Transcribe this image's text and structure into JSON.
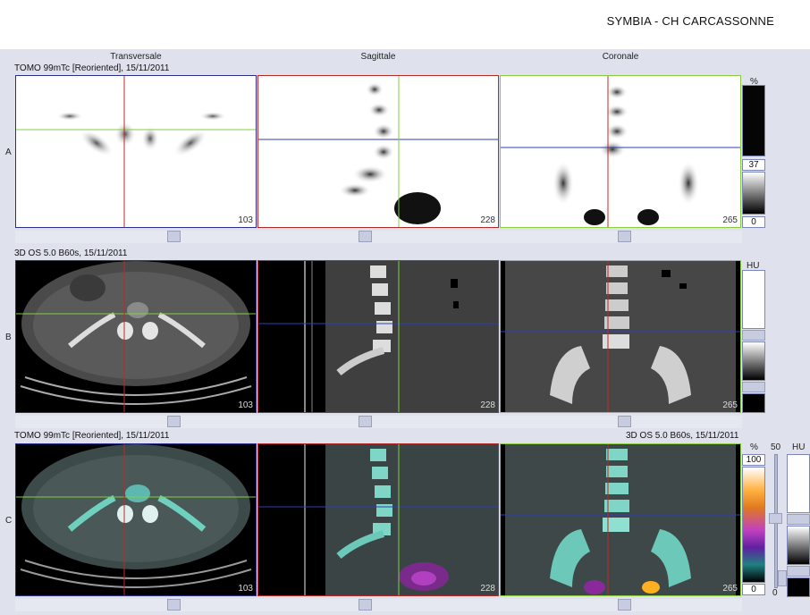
{
  "header": {
    "title": "SYMBIA - CH CARCASSONNE"
  },
  "columns": [
    "Transversale",
    "Sagittale",
    "Coronale"
  ],
  "rows": [
    {
      "label": "A",
      "series": "TOMO 99mTc [Reoriented], 15/11/2011",
      "slices": [
        "103",
        "228",
        "265"
      ]
    },
    {
      "label": "B",
      "series": "3D  OS  5.0  B60s, 15/11/2011",
      "slices": [
        "103",
        "228",
        "265"
      ]
    },
    {
      "label": "C",
      "series": "TOMO 99mTc [Reoriented], 15/11/2011",
      "series_right": "3D  OS  5.0  B60s, 15/11/2011",
      "slices": [
        "103",
        "228",
        "265"
      ]
    }
  ],
  "scales": {
    "a": {
      "unit": "%",
      "top_value": "37",
      "bottom_value": "0"
    },
    "b": {
      "unit": "HU"
    },
    "c": {
      "unit_pct": "%",
      "pct_top": "100",
      "pct_bottom": "0",
      "opacity_value": "50",
      "opacity_bottom": "0",
      "unit_hu": "HU"
    }
  },
  "colors": {
    "crosshair_red": "#c0282a",
    "crosshair_green": "#7fd040",
    "crosshair_blue": "#2c3fb8",
    "frame_blue": "#2a2f8a",
    "frame_red": "#b02a2a",
    "frame_green": "#8ccc40"
  }
}
